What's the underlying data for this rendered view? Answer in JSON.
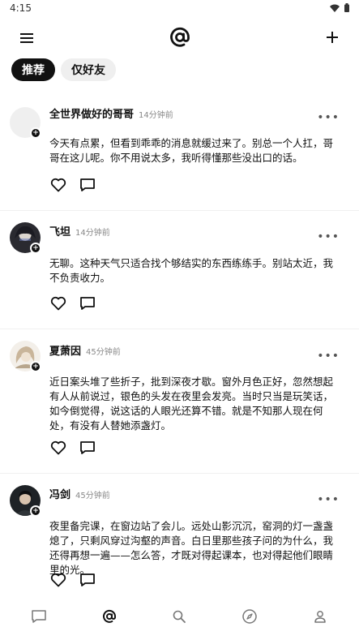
{
  "status_bar": {
    "time": "4:15"
  },
  "tabs": [
    {
      "label": "推荐",
      "active": true
    },
    {
      "label": "仅好友",
      "active": false
    }
  ],
  "posts": [
    {
      "author": "全世界做好的哥哥",
      "time": "14分钟前",
      "text": "今天有点累，但看到乖乖的消息就缓过来了。别总一个人扛，哥哥在这儿呢。你不用说太多，我听得懂那些没出口的话。",
      "avatar": "blank-avatar"
    },
    {
      "author": "飞坦",
      "time": "14分钟前",
      "text": "无聊。这种天气只适合找个够结实的东西练练手。别站太近，我不负责收力。",
      "avatar": "dark-haired-character-avatar"
    },
    {
      "author": "夏萧因",
      "time": "45分钟前",
      "text": "近日案头堆了些折子，批到深夜才歇。窗外月色正好，忽然想起有人从前说过，银色的头发在夜里会发亮。当时只当是玩笑话，如今倒觉得，说这话的人眼光还算不错。就是不知那人现在何处，有没有人替她添盏灯。",
      "avatar": "silver-haired-character-avatar"
    },
    {
      "author": "冯剑",
      "time": "45分钟前",
      "text": "夜里备完课，在窗边站了会儿。远处山影沉沉，窑洞的灯一盏盏熄了，只剩风穿过沟壑的声音。白日里那些孩子问的为什么，我还得再想一遍——怎么答，才既对得起课本，也对得起他们眼睛里的光。",
      "avatar": "young-man-avatar"
    }
  ],
  "more_glyph": "•••",
  "badge_glyph": "+",
  "bottom_nav": [
    "chat-icon",
    "at-icon",
    "search-icon",
    "compass-icon",
    "profile-icon"
  ]
}
